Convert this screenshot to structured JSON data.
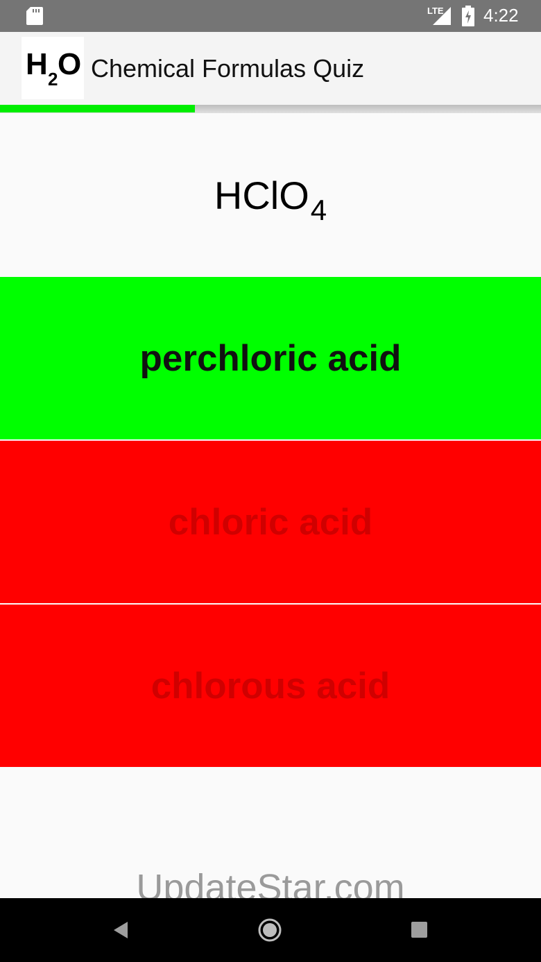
{
  "status_bar": {
    "network": "LTE",
    "time": "4:22",
    "icons": [
      "sd-card-icon",
      "signal-icon",
      "battery-charging-icon"
    ]
  },
  "app_bar": {
    "logo": {
      "main": "H",
      "subscript": "2",
      "end": "O"
    },
    "title": "Chemical Formulas Quiz"
  },
  "progress": {
    "fraction": 0.36,
    "color": "#00ee00"
  },
  "question": {
    "formula": "HClO",
    "subscript": "4"
  },
  "answers": [
    {
      "label": "perchloric acid",
      "state": "correct",
      "background": "#00ff00"
    },
    {
      "label": "chloric acid",
      "state": "wrong",
      "background": "#ff0000"
    },
    {
      "label": "chlorous acid",
      "state": "wrong",
      "background": "#ff0000"
    }
  ],
  "watermark": "UpdateStar.com",
  "nav_bar": {
    "icons": [
      "back-icon",
      "home-icon",
      "recents-icon"
    ]
  }
}
